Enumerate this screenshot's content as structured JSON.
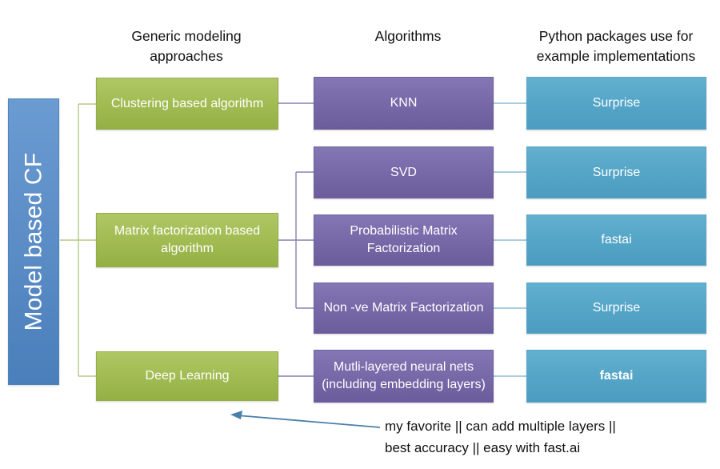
{
  "diagram": {
    "title_root": "Model based CF",
    "headers": [
      {
        "id": "header-generic-modeling",
        "label": "Generic modeling approaches"
      },
      {
        "id": "header-algorithms",
        "label": "Algorithms"
      },
      {
        "id": "header-python-packages",
        "label": "Python packages use for example implementations"
      }
    ],
    "approaches": [
      {
        "id": "clustering",
        "label": "Clustering based algorithm"
      },
      {
        "id": "matrix-factorization",
        "label": "Matrix factorization based algorithm"
      },
      {
        "id": "deep-learning",
        "label": "Deep Learning"
      }
    ],
    "algorithms": [
      {
        "id": "knn",
        "label": "KNN"
      },
      {
        "id": "svd",
        "label": "SVD"
      },
      {
        "id": "pmf",
        "label": "Probabilistic Matrix Factorization"
      },
      {
        "id": "nmf",
        "label": "Non -ve Matrix Factorization"
      },
      {
        "id": "dnn",
        "label": "Mutli-layered neural nets (including embedding layers)"
      }
    ],
    "packages": [
      {
        "id": "pkg-knn",
        "label": "Surprise",
        "bold": false
      },
      {
        "id": "pkg-svd",
        "label": "Surprise",
        "bold": false
      },
      {
        "id": "pkg-pmf",
        "label": "fastai",
        "bold": false
      },
      {
        "id": "pkg-nmf",
        "label": "Surprise",
        "bold": false
      },
      {
        "id": "pkg-dnn",
        "label": "fastai",
        "bold": true
      }
    ],
    "annotation": {
      "text": "my favorite || can add multiple layers ||\nbest accuracy || easy with fast.ai"
    },
    "colors": {
      "root_blue": "#5d8ec7",
      "approach_green": "#a3bd54",
      "algorithm_purple": "#7a6bab",
      "package_teal": "#56a6c8",
      "connector_green": "#b5c98a",
      "connector_purple": "#8a80b4",
      "connector_teal": "#8fbcd0",
      "arrow_blue": "#4a7fa8",
      "text_dark": "#111111",
      "text_light": "#ffffff",
      "background": "#ffffff"
    }
  }
}
